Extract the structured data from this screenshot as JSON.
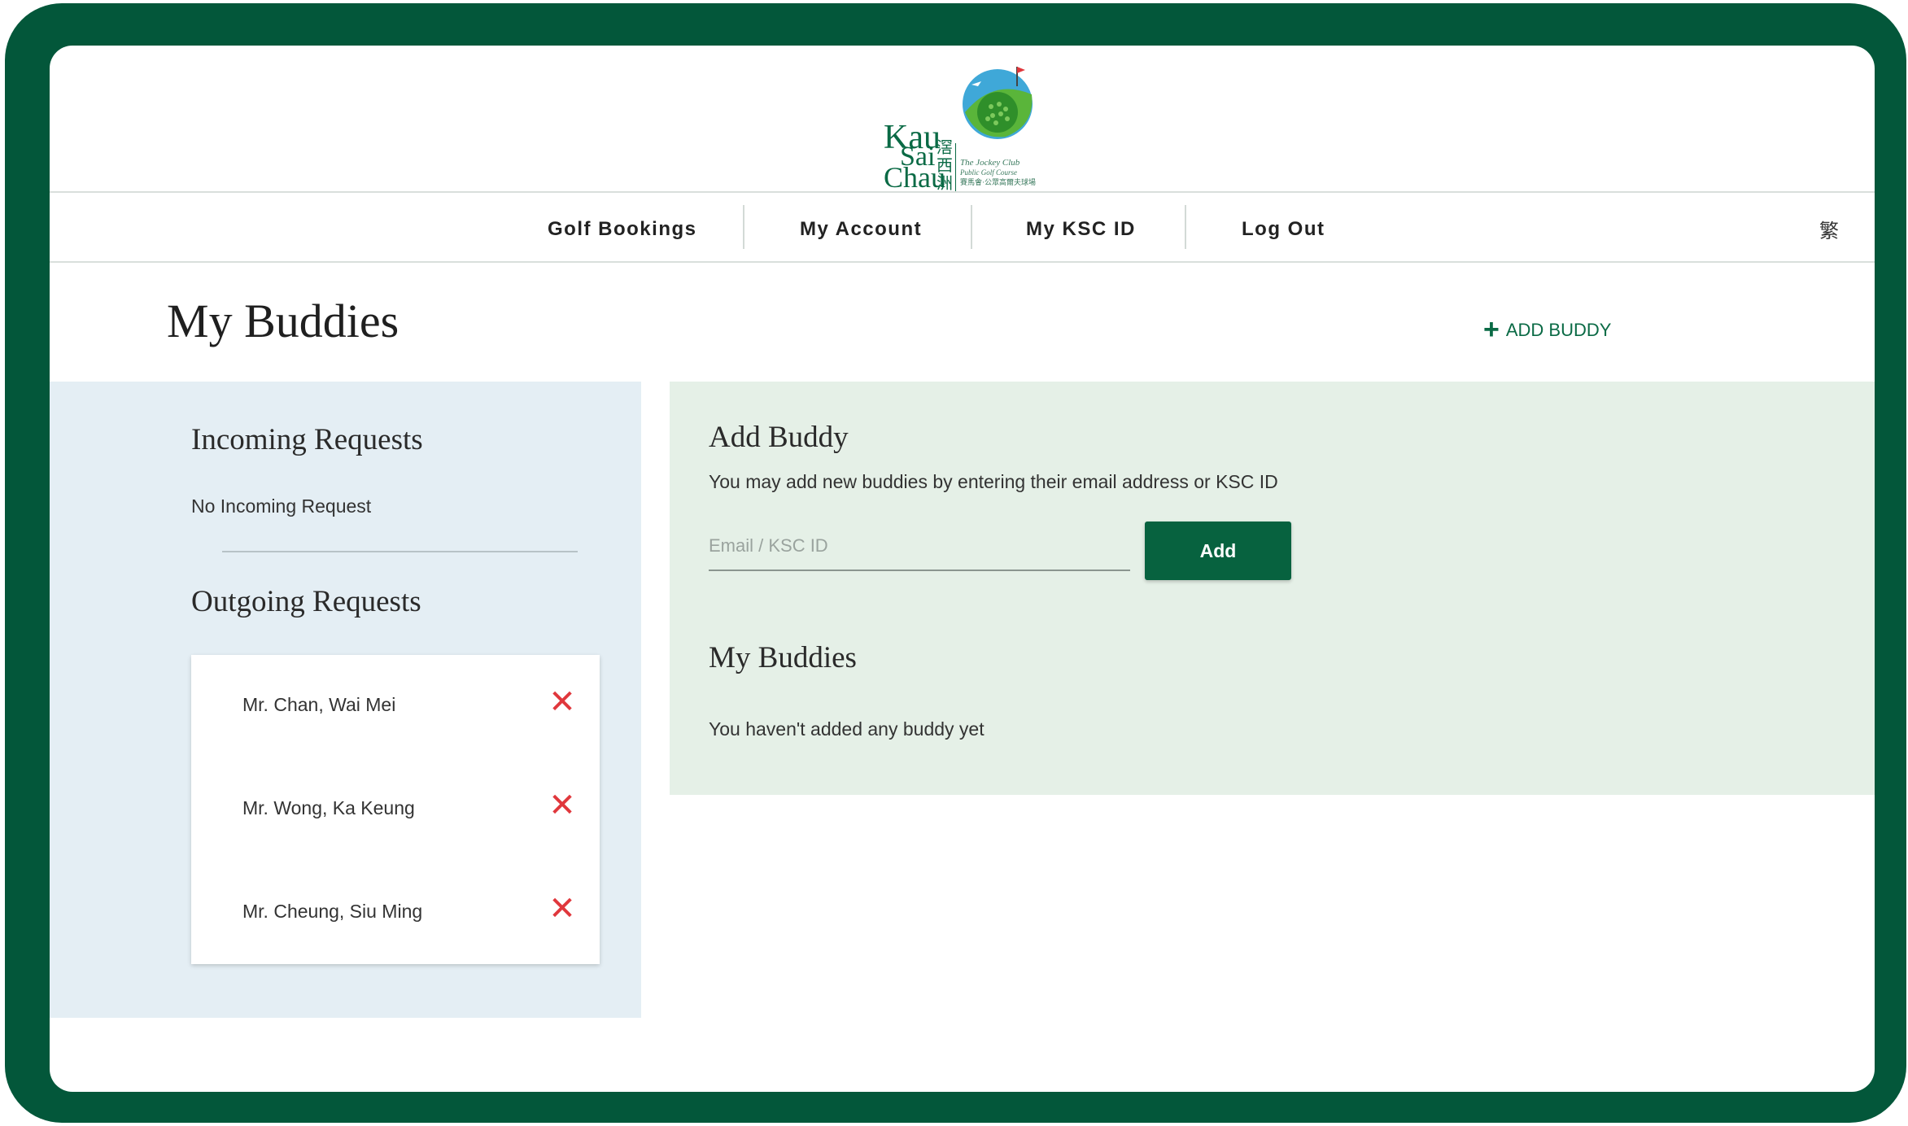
{
  "logo": {
    "line1": "Kau",
    "line2": "Sai",
    "line3": "Chau",
    "cn1": "滘",
    "cn2": "西",
    "cn3": "洲",
    "tagline1": "The Jockey Club",
    "tagline2": "Public Golf Course",
    "tagline3": "賽馬會·公眾高爾夫球場"
  },
  "nav": {
    "items": [
      {
        "label": "Golf Bookings"
      },
      {
        "label": "My Account"
      },
      {
        "label": "My KSC ID"
      },
      {
        "label": "Log Out"
      }
    ],
    "language": "繁"
  },
  "page": {
    "title": "My Buddies",
    "add_buddy_link": "ADD BUDDY"
  },
  "incoming": {
    "title": "Incoming Requests",
    "empty_text": "No Incoming Request"
  },
  "outgoing": {
    "title": "Outgoing Requests",
    "requests": [
      {
        "name": "Mr. Chan, Wai Mei"
      },
      {
        "name": "Mr. Wong, Ka Keung"
      },
      {
        "name": "Mr. Cheung, Siu Ming"
      }
    ]
  },
  "add_buddy": {
    "title": "Add Buddy",
    "description": "You may add new buddies by entering their email address or KSC ID",
    "input_placeholder": "Email / KSC ID",
    "input_value": "",
    "button_label": "Add"
  },
  "my_buddies": {
    "title": "My Buddies",
    "empty_text": "You haven't added any buddy yet"
  },
  "colors": {
    "frame": "#03573a",
    "brand_green": "#07623f",
    "left_panel_bg": "#e4eef4",
    "right_panel_bg": "#e5f0e7",
    "remove_red": "#e0373c"
  },
  "icons": [
    "golf-ball-logo-icon",
    "plus-icon",
    "close-icon"
  ]
}
